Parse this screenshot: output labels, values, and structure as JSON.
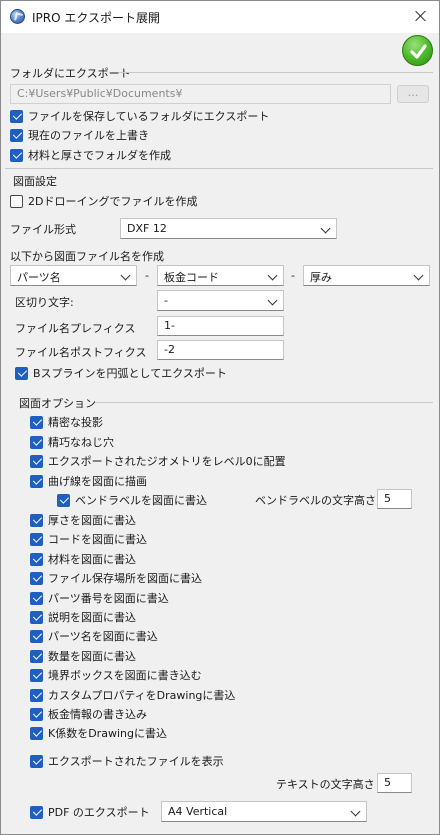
{
  "window": {
    "title": "IPRO エクスポート展開"
  },
  "folder": {
    "group_label": "フォルダにエクスポート",
    "path_value": "C:¥Users¥Public¥Documents¥",
    "browse_label": "...",
    "opt_save_folder": "ファイルを保存しているフォルダにエクスポート",
    "opt_overwrite": "現在のファイルを上書き",
    "opt_material_folder": "材料と厚さでフォルダを作成"
  },
  "drawing": {
    "group_label": "図面設定",
    "opt_2d": "2Dドローイングでファイルを作成",
    "format_label": "ファイル形式",
    "format_value": "DXF 12",
    "name_from_label": "以下から図面ファイル名を作成",
    "name_parts": [
      "パーツ名",
      "板金コード",
      "厚み"
    ],
    "name_part_dash": "-",
    "separator_label": "区切り文字:",
    "separator_value": "-",
    "prefix_label": "ファイル名プレフィクス",
    "prefix_value": "1-",
    "suffix_label": "ファイル名ポストフィクス",
    "suffix_value": "-2",
    "opt_bspline": "Bスプラインを円弧としてエクスポート"
  },
  "options": {
    "group_label": "図面オプション",
    "precise_projection": "精密な投影",
    "fine_thread": "精巧なねじ穴",
    "geometry_level0": "エクスポートされたジオメトリをレベル0に配置",
    "draw_bend_lines": "曲げ線を図面に描画",
    "bend_labels": "ベンドラベルを図面に書込",
    "bend_label_height_label": "ベンドラベルの文字高さ",
    "bend_label_height_value": "5",
    "write_thickness": "厚さを図面に書込",
    "write_code": "コードを図面に書込",
    "write_material": "材料を図面に書込",
    "write_location": "ファイル保存場所を図面に書込",
    "write_part_number": "パーツ番号を図面に書込",
    "write_description": "説明を図面に書込",
    "write_part_name": "パーツ名を図面に書込",
    "write_quantity": "数量を図面に書込",
    "write_bounding_box": "境界ボックスを図面に書き込む",
    "write_custom_props": "カスタムプロパティをDrawingに書込",
    "write_sheet_info": "板金情報の書き込み",
    "write_k_factor": "K係数をDrawingに書込",
    "show_exported": "エクスポートされたファイルを表示",
    "text_height_label": "テキストの文字高さ",
    "text_height_value": "5",
    "pdf_export": "PDF のエクスポート",
    "pdf_page_value": "A4 Vertical"
  }
}
